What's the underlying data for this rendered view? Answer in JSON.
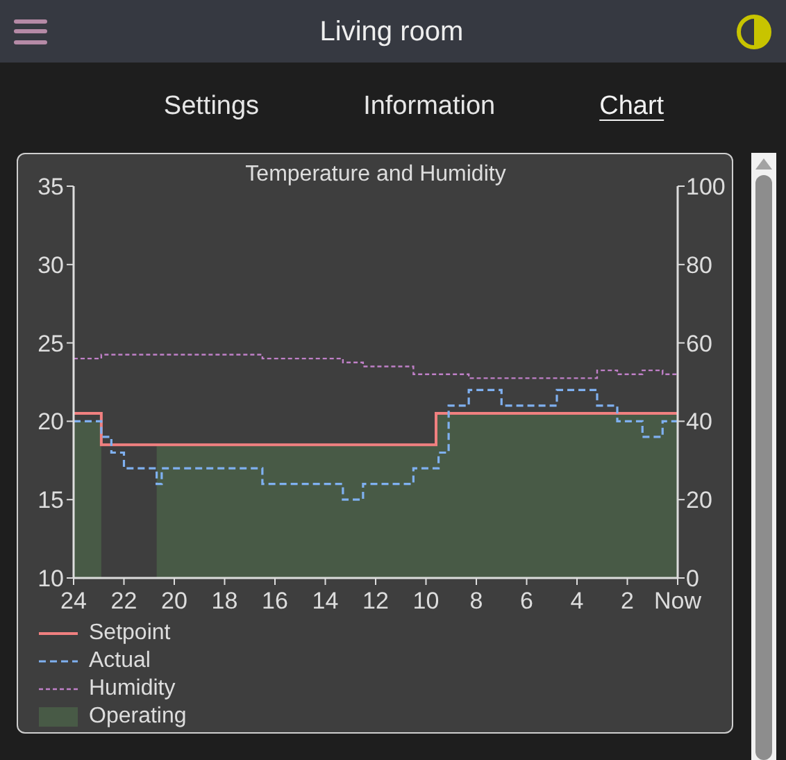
{
  "header": {
    "title": "Living room"
  },
  "tabs": [
    {
      "label": "Settings",
      "selected": false
    },
    {
      "label": "Information",
      "selected": false
    },
    {
      "label": "Chart",
      "selected": true
    }
  ],
  "chart_data": {
    "type": "line",
    "title": "Temperature and Humidity",
    "x": [
      24,
      22.9,
      22.9,
      22.5,
      22.5,
      22,
      22,
      20.7,
      20.7,
      20.5,
      20.5,
      16.5,
      16.5,
      15.5,
      15.5,
      13.3,
      13.3,
      12.5,
      12.5,
      12,
      12,
      10.5,
      10.5,
      9.6,
      9.6,
      9.5,
      9.5,
      9.1,
      9.1,
      8.3,
      8.3,
      7,
      7,
      5,
      5,
      4.8,
      4.8,
      3.2,
      3.2,
      3,
      3,
      2.4,
      2.4,
      1.4,
      1.4,
      1,
      1,
      0.6,
      0.6,
      0
    ],
    "xlim": [
      24,
      0
    ],
    "ylim": [
      10,
      35
    ],
    "y2lim": [
      0,
      100
    ],
    "xticks": [
      24,
      22,
      20,
      18,
      16,
      14,
      12,
      10,
      8,
      6,
      4,
      2,
      {
        "value": 0,
        "label": "Now"
      }
    ],
    "yticks": [
      10,
      15,
      20,
      25,
      30,
      35
    ],
    "y2ticks": [
      0,
      20,
      40,
      60,
      80,
      100
    ],
    "series": [
      {
        "name": "Setpoint",
        "color": "#f08080",
        "line_style": "solid",
        "values": [
          20.5,
          20.5,
          18.5,
          18.5,
          18.5,
          18.5,
          18.5,
          18.5,
          18.5,
          18.5,
          18.5,
          18.5,
          18.5,
          18.5,
          18.5,
          18.5,
          18.5,
          18.5,
          18.5,
          18.5,
          18.5,
          18.5,
          18.5,
          18.5,
          20.5,
          20.5,
          20.5,
          20.5,
          20.5,
          20.5,
          20.5,
          20.5,
          20.5,
          20.5,
          20.5,
          20.5,
          20.5,
          20.5,
          20.5,
          20.5,
          20.5,
          20.5,
          20.5,
          20.5,
          20.5,
          20.5,
          20.5,
          20.5,
          20.5,
          20.5
        ]
      },
      {
        "name": "Actual",
        "color": "#7fb0f0",
        "line_style": "dashed",
        "values": [
          20,
          20,
          19,
          19,
          18,
          18,
          17,
          17,
          16,
          16,
          17,
          17,
          16,
          16,
          16,
          16,
          15,
          15,
          16,
          16,
          16,
          16,
          17,
          17,
          17,
          17,
          18,
          18,
          21,
          21,
          22,
          22,
          21,
          21,
          21,
          21,
          22,
          22,
          21,
          21,
          21,
          21,
          20,
          20,
          19,
          19,
          19,
          19,
          20,
          20
        ]
      },
      {
        "name": "Humidity",
        "color": "#c080c8",
        "line_style": "dotted",
        "axis": "y2",
        "values": [
          56,
          56,
          57,
          57,
          57,
          57,
          57,
          57,
          57,
          57,
          57,
          57,
          56,
          56,
          56,
          56,
          55,
          55,
          54,
          54,
          54,
          54,
          52,
          52,
          52,
          52,
          52,
          52,
          52,
          52,
          51,
          51,
          51,
          51,
          51,
          51,
          51,
          51,
          53,
          53,
          53,
          53,
          52,
          52,
          53,
          53,
          53,
          53,
          52,
          52
        ]
      },
      {
        "name": "Operating",
        "color": "#485a46",
        "type": "area",
        "values": [
          20,
          20,
          null,
          null,
          null,
          null,
          null,
          null,
          18.5,
          18.5,
          18.5,
          18.5,
          18.5,
          18.5,
          18.5,
          18.5,
          18.5,
          18.5,
          18.5,
          18.5,
          18.5,
          18.5,
          18.5,
          18.5,
          20.5,
          20.5,
          20.5,
          20.5,
          20.5,
          20.5,
          20.5,
          20.5,
          20.5,
          20.5,
          20.5,
          20.5,
          20.5,
          20.5,
          20.5,
          20.5,
          20.5,
          20.5,
          20.5,
          20.5,
          20.5,
          20.5,
          20.5,
          20.5,
          20.5,
          20.5
        ]
      }
    ]
  }
}
